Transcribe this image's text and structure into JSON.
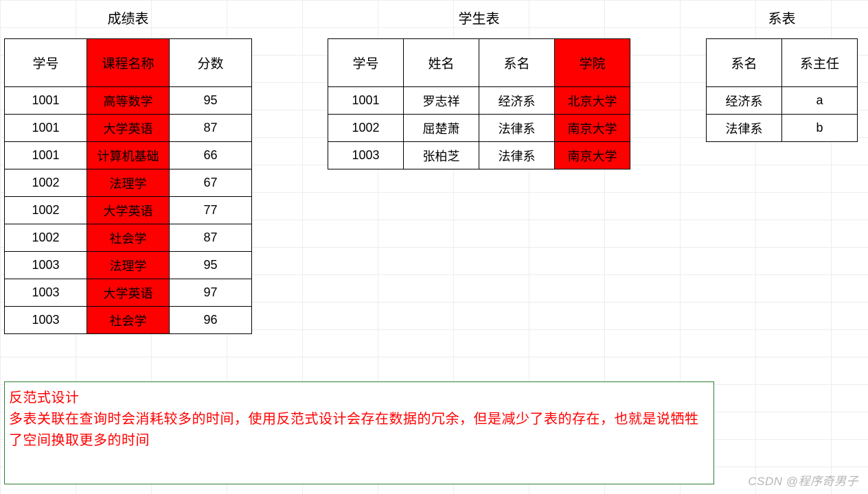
{
  "tables": {
    "score": {
      "title": "成绩表",
      "headers": {
        "id": "学号",
        "course": "课程名称",
        "points": "分数"
      },
      "rows": [
        {
          "id": "1001",
          "course": "高等数学",
          "points": "95"
        },
        {
          "id": "1001",
          "course": "大学英语",
          "points": "87"
        },
        {
          "id": "1001",
          "course": "计算机基础",
          "points": "66"
        },
        {
          "id": "1002",
          "course": "法理学",
          "points": "67"
        },
        {
          "id": "1002",
          "course": "大学英语",
          "points": "77"
        },
        {
          "id": "1002",
          "course": "社会学",
          "points": "87"
        },
        {
          "id": "1003",
          "course": "法理学",
          "points": "95"
        },
        {
          "id": "1003",
          "course": "大学英语",
          "points": "97"
        },
        {
          "id": "1003",
          "course": "社会学",
          "points": "96"
        }
      ]
    },
    "student": {
      "title": "学生表",
      "headers": {
        "id": "学号",
        "name": "姓名",
        "dept": "系名",
        "college": "学院"
      },
      "rows": [
        {
          "id": "1001",
          "name": "罗志祥",
          "dept": "经济系",
          "college": "北京大学"
        },
        {
          "id": "1002",
          "name": "屈楚萧",
          "dept": "法律系",
          "college": "南京大学"
        },
        {
          "id": "1003",
          "name": "张柏芝",
          "dept": "法律系",
          "college": "南京大学"
        }
      ]
    },
    "dept": {
      "title": "系表",
      "headers": {
        "dept": "系名",
        "head": "系主任"
      },
      "rows": [
        {
          "dept": "经济系",
          "head": "a"
        },
        {
          "dept": "法律系",
          "head": "b"
        }
      ]
    }
  },
  "note": {
    "line1": "反范式设计",
    "line2": "多表关联在查询时会消耗较多的时间，使用反范式设计会存在数据的冗余，但是减少了表的存在，也就是说牺牲了空间换取更多的时间"
  },
  "watermark": "CSDN @程序奇男子"
}
